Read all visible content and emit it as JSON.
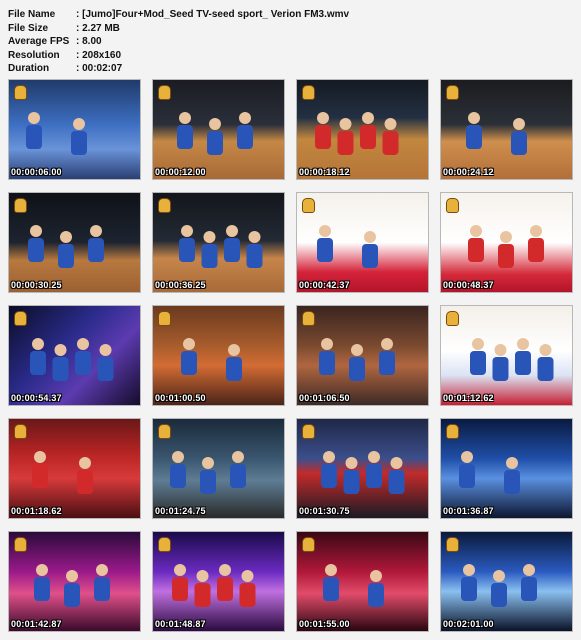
{
  "info": {
    "rows": [
      {
        "label": "File Name",
        "value": ": [Jumo]Four+Mod_Seed TV-seed sport_ Verion FM3.wmv"
      },
      {
        "label": "File Size",
        "value": ": 2.27 MB"
      },
      {
        "label": "Average FPS",
        "value": ": 8.00"
      },
      {
        "label": "Resolution",
        "value": ": 208x160"
      },
      {
        "label": "Duration",
        "value": ": 00:02:07"
      }
    ]
  },
  "thumbnails": [
    {
      "time": "00:00:06.00",
      "scene": "crowd-blue"
    },
    {
      "time": "00:00:12.00",
      "scene": "court-players"
    },
    {
      "time": "00:00:18.12",
      "scene": "court-wide"
    },
    {
      "time": "00:00:24.12",
      "scene": "court-two"
    },
    {
      "time": "00:00:30.25",
      "scene": "court-dark"
    },
    {
      "time": "00:00:36.25",
      "scene": "court-group"
    },
    {
      "time": "00:00:42.37",
      "scene": "studio-two"
    },
    {
      "time": "00:00:48.37",
      "scene": "studio-one"
    },
    {
      "time": "00:00:54.37",
      "scene": "cheer-dark"
    },
    {
      "time": "00:01:00.50",
      "scene": "arena-orange"
    },
    {
      "time": "00:01:06.50",
      "scene": "arena-crowd"
    },
    {
      "time": "00:01:12.62",
      "scene": "studio-pair"
    },
    {
      "time": "00:01:18.62",
      "scene": "fans-red"
    },
    {
      "time": "00:01:24.75",
      "scene": "group-walk"
    },
    {
      "time": "00:01:30.75",
      "scene": "group-stage"
    },
    {
      "time": "00:01:36.87",
      "scene": "stage-blue"
    },
    {
      "time": "00:01:42.87",
      "scene": "stage-pink"
    },
    {
      "time": "00:01:48.87",
      "scene": "stage-purple"
    },
    {
      "time": "00:01:55.00",
      "scene": "stage-red"
    },
    {
      "time": "00:02:01.00",
      "scene": "singer-blue"
    }
  ]
}
